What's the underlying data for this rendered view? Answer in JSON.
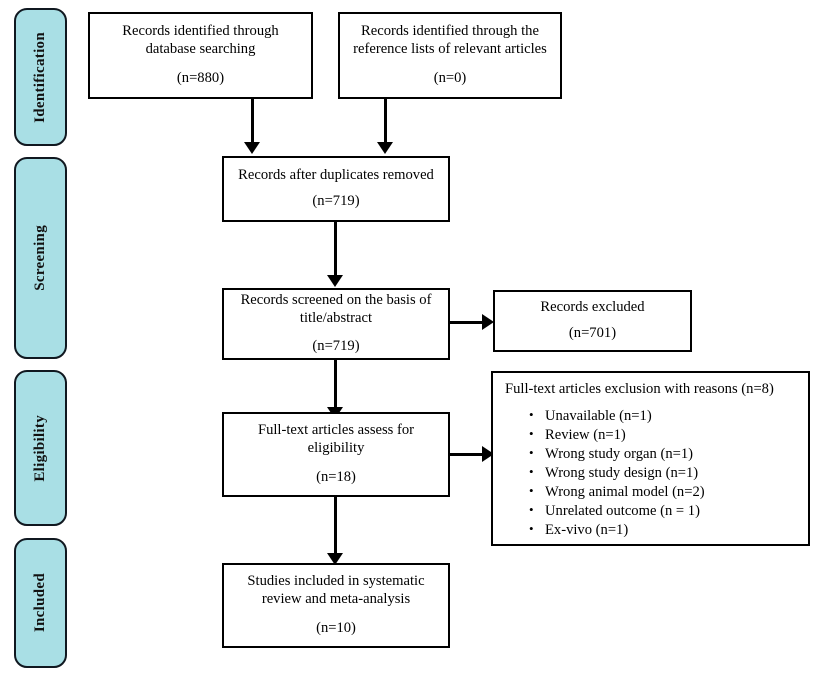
{
  "diagram": {
    "title": "PRISMA study selection flow diagram",
    "accent_color": "#a9dfe5",
    "line_color": "#000000",
    "background": "#ffffff"
  },
  "stages": [
    {
      "label": "Identification"
    },
    {
      "label": "Screening"
    },
    {
      "label": "Eligibility"
    },
    {
      "label": "Included"
    }
  ],
  "boxes": {
    "database_search": {
      "line1": "Records identified through",
      "line2": "database searching",
      "count": "(n=880)"
    },
    "reference_lists": {
      "line1": "Records identified through the",
      "line2": "reference lists of relevant articles",
      "count": "(n=0)"
    },
    "duplicates_removed": {
      "line1": "Records after duplicates removed",
      "count": "(n=719)"
    },
    "records_screened": {
      "line1": "Records screened on the basis of",
      "line2": "title/abstract",
      "count": "(n=719)"
    },
    "records_excluded": {
      "line1": "Records excluded",
      "count": "(n=701)"
    },
    "fulltext_assessed": {
      "line1": "Full-text articles assess for",
      "line2": "eligibility",
      "count": "(n=18)"
    },
    "studies_included": {
      "line1": "Studies included in systematic",
      "line2": "review and meta-analysis",
      "count": "(n=10)"
    },
    "fulltext_excluded": {
      "title": "Full-text articles exclusion with reasons (n=8)",
      "reasons": [
        "Unavailable (n=1)",
        "Review (n=1)",
        "Wrong study organ (n=1)",
        "Wrong study design (n=1)",
        "Wrong animal model (n=2)",
        "Unrelated outcome (n = 1)",
        "Ex-vivo (n=1)"
      ]
    }
  }
}
